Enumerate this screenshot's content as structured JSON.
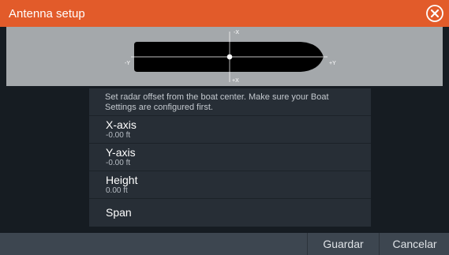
{
  "dialog": {
    "title": "Antenna setup",
    "close_icon": "close-circle-icon"
  },
  "diagram": {
    "label_top": "-X",
    "label_bottom": "+X",
    "label_left": "-Y",
    "label_right": "+Y",
    "boat_color": "#000000",
    "antenna_marker_color": "#ffffff"
  },
  "settings": {
    "info": "Set radar offset from the boat center. Make sure your Boat Settings are configured first.",
    "rows": [
      {
        "label": "X-axis",
        "value": "-0.00 ft"
      },
      {
        "label": "Y-axis",
        "value": "-0.00 ft"
      },
      {
        "label": "Height",
        "value": "0.00 ft"
      },
      {
        "label": "Span"
      }
    ]
  },
  "footer": {
    "save_label": "Guardar",
    "cancel_label": "Cancelar"
  },
  "colors": {
    "titlebar": "#e25b2a",
    "diagram_bg": "#a4a8ab",
    "panel_bg": "#272e36",
    "footer_bg": "#3d4650"
  }
}
